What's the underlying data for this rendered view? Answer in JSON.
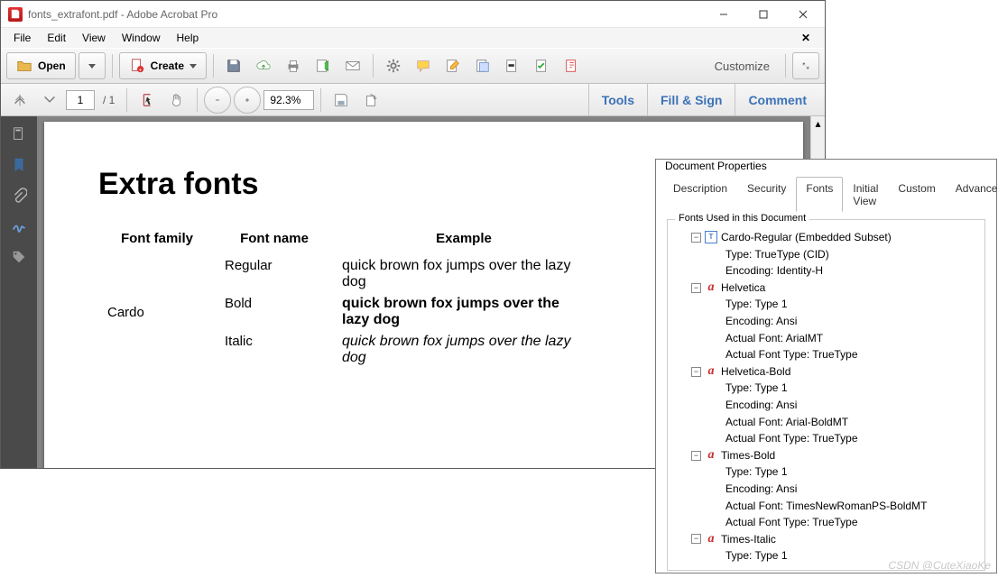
{
  "window": {
    "title": "fonts_extrafont.pdf - Adobe Acrobat Pro",
    "menus": [
      "File",
      "Edit",
      "View",
      "Window",
      "Help"
    ]
  },
  "toolbar": {
    "open_label": "Open",
    "create_label": "Create",
    "customize_label": "Customize"
  },
  "nav": {
    "page_current": "1",
    "page_total": "/ 1",
    "zoom": "92.3%"
  },
  "actions": {
    "tools": "Tools",
    "fillsign": "Fill & Sign",
    "comment": "Comment"
  },
  "doc": {
    "heading": "Extra fonts",
    "headers": {
      "family": "Font family",
      "name": "Font name",
      "example": "Example"
    },
    "family": "Cardo",
    "rows": [
      {
        "name": "Regular",
        "example": "quick brown fox jumps over the lazy dog",
        "cls": "ex-reg"
      },
      {
        "name": "Bold",
        "example": "quick brown fox jumps over the lazy dog",
        "cls": "ex-bold"
      },
      {
        "name": "Italic",
        "example": "quick brown fox jumps over the lazy dog",
        "cls": "ex-ital"
      }
    ]
  },
  "dialog": {
    "title": "Document Properties",
    "tabs": [
      "Description",
      "Security",
      "Fonts",
      "Initial View",
      "Custom",
      "Advanced"
    ],
    "active_tab": 2,
    "group_label": "Fonts Used in this Document",
    "fonts": [
      {
        "name": "Cardo-Regular (Embedded Subset)",
        "icon": "tt",
        "props": [
          "Type: TrueType (CID)",
          "Encoding: Identity-H"
        ]
      },
      {
        "name": "Helvetica",
        "icon": "aa",
        "props": [
          "Type: Type 1",
          "Encoding: Ansi",
          "Actual Font: ArialMT",
          "Actual Font Type: TrueType"
        ]
      },
      {
        "name": "Helvetica-Bold",
        "icon": "aa",
        "props": [
          "Type: Type 1",
          "Encoding: Ansi",
          "Actual Font: Arial-BoldMT",
          "Actual Font Type: TrueType"
        ]
      },
      {
        "name": "Times-Bold",
        "icon": "aa",
        "props": [
          "Type: Type 1",
          "Encoding: Ansi",
          "Actual Font: TimesNewRomanPS-BoldMT",
          "Actual Font Type: TrueType"
        ]
      },
      {
        "name": "Times-Italic",
        "icon": "aa",
        "props": [
          "Type: Type 1"
        ]
      }
    ]
  },
  "watermark": "CSDN @CuteXiaoKe"
}
